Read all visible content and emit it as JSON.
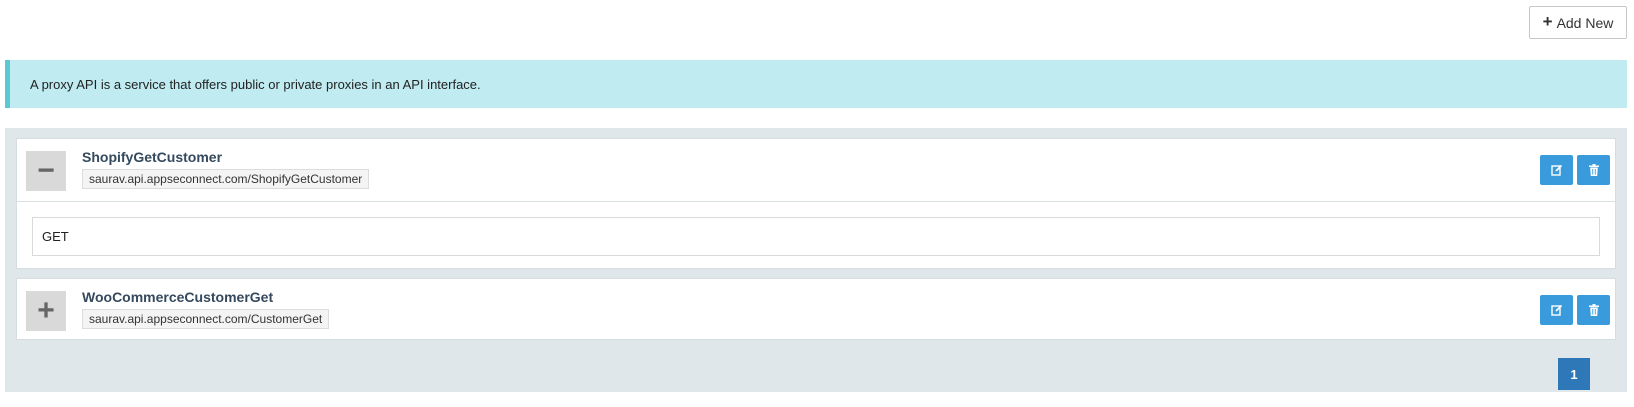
{
  "toolbar": {
    "add_label": "Add New"
  },
  "info": {
    "text": "A proxy API is a service that offers public or private proxies in an API interface."
  },
  "proxies": [
    {
      "name": "ShopifyGetCustomer",
      "url": "saurav.api.appseconnect.com/ShopifyGetCustomer",
      "toggle": "−",
      "expanded": true,
      "method": "GET"
    },
    {
      "name": "WooCommerceCustomerGet",
      "url": "saurav.api.appseconnect.com/CustomerGet",
      "toggle": "+",
      "expanded": false
    }
  ],
  "pagination": {
    "current": "1"
  },
  "colors": {
    "accent": "#3a9bdc",
    "info_bg": "#bfebf1",
    "info_border": "#5bc8d4",
    "panel_bg": "#dfe7ea",
    "page_active": "#2f78b7"
  }
}
